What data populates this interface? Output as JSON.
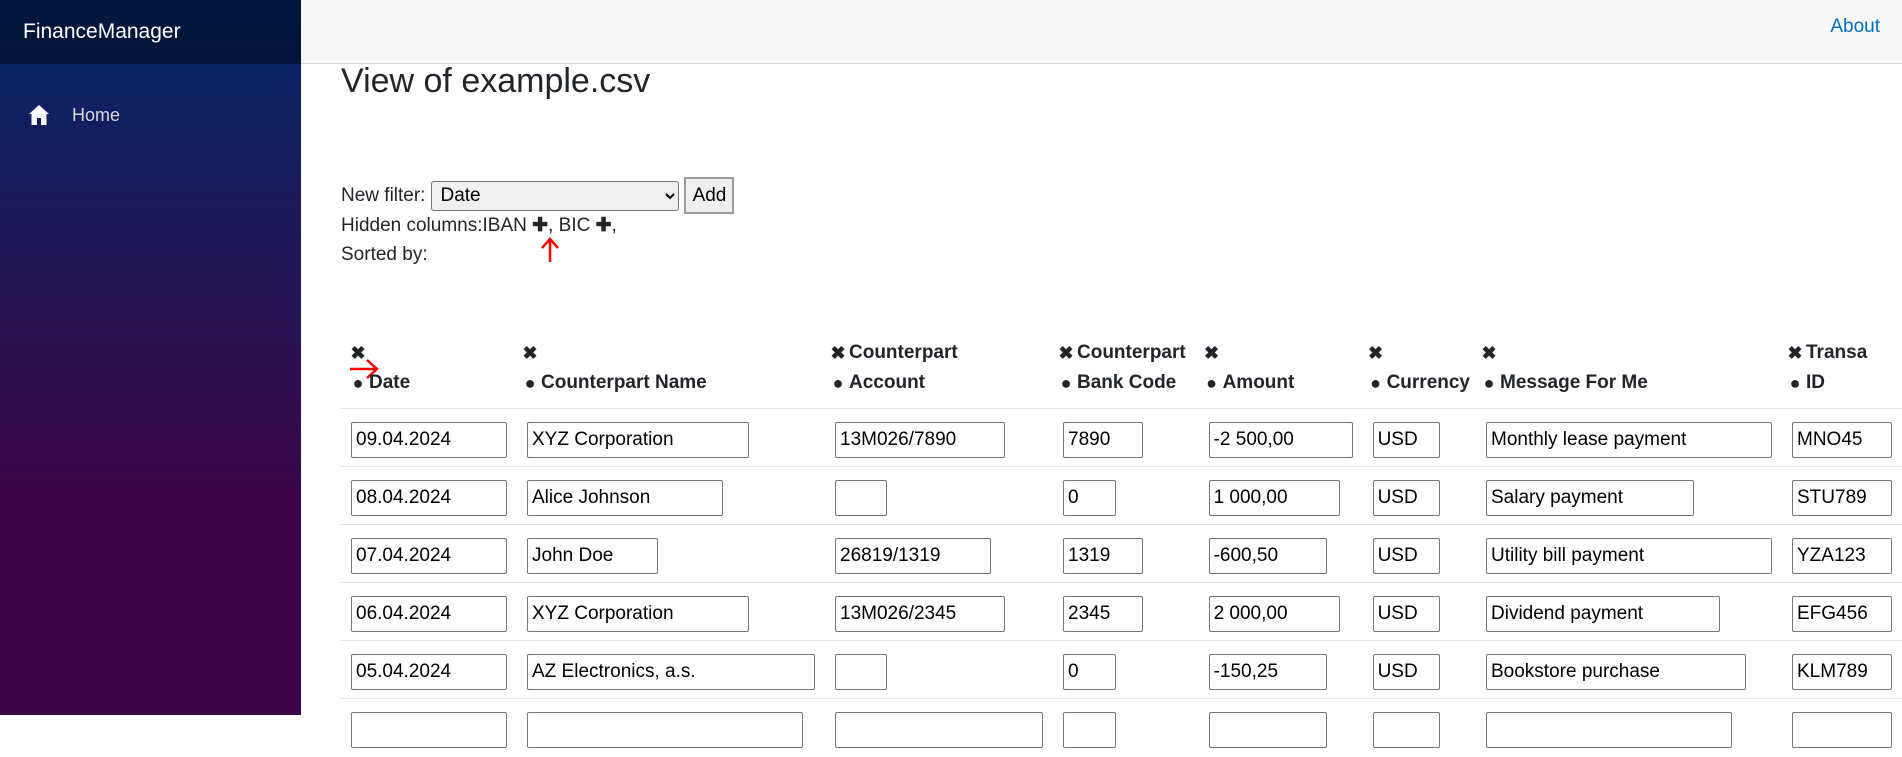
{
  "app": {
    "brand": "FinanceManager",
    "about_label": "About"
  },
  "sidebar": {
    "items": [
      {
        "label": "Home",
        "icon": "home-icon"
      }
    ]
  },
  "page": {
    "title": "View of example.csv"
  },
  "filter": {
    "label": "New filter:",
    "selected": "Date",
    "add_label": "Add"
  },
  "hidden": {
    "label": "Hidden columns:",
    "columns": [
      "IBAN",
      "BIC"
    ]
  },
  "sorted": {
    "label": "Sorted by:"
  },
  "accent_color": "#ff0000",
  "table": {
    "columns": [
      {
        "line1": "",
        "line2": "Date"
      },
      {
        "line1": "",
        "line2": "Counterpart Name"
      },
      {
        "line1": "Counterpart",
        "line2": "Account"
      },
      {
        "line1": "Counterpart",
        "line2": "Bank Code"
      },
      {
        "line1": "",
        "line2": "Amount"
      },
      {
        "line1": "",
        "line2": "Currency"
      },
      {
        "line1": "",
        "line2": "Message For Me"
      },
      {
        "line1": "Transa",
        "line2": "ID"
      }
    ],
    "rows": [
      [
        "09.04.2024",
        "XYZ Corporation",
        "13M026/7890",
        "7890",
        "-2 500,00",
        "USD",
        "Monthly lease payment",
        "MNO45"
      ],
      [
        "08.04.2024",
        "Alice Johnson",
        "",
        "0",
        "1 000,00",
        "USD",
        "Salary payment",
        "STU789"
      ],
      [
        "07.04.2024",
        "John Doe",
        "26819/1319",
        "1319",
        "-600,50",
        "USD",
        "Utility bill payment",
        "YZA123"
      ],
      [
        "06.04.2024",
        "XYZ Corporation",
        "13M026/2345",
        "2345",
        "2 000,00",
        "USD",
        "Dividend payment",
        "EFG456"
      ],
      [
        "05.04.2024",
        "AZ Electronics, a.s.",
        "",
        "0",
        "-150,25",
        "USD",
        "Bookstore purchase",
        "KLM789"
      ]
    ]
  }
}
